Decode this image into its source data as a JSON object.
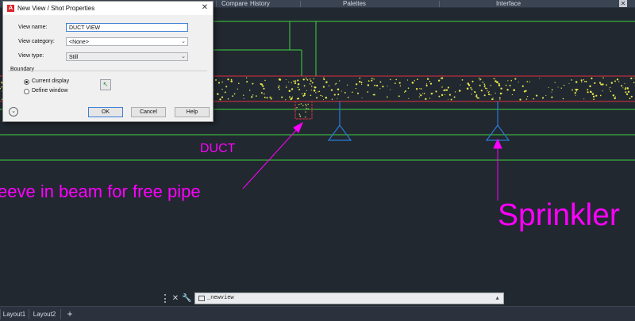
{
  "ribbon": {
    "tabs": [
      {
        "label": "Compare"
      },
      {
        "label": "History"
      },
      {
        "label": "Palettes"
      },
      {
        "label": "Interface"
      }
    ]
  },
  "drawing": {
    "annotations": {
      "duct": "DUCT",
      "sleeve": "eeve in beam for free pipe",
      "sprinkler": "Sprinkler"
    },
    "colors": {
      "background": "#212830",
      "green_lines": "#3fd23f",
      "red_beam": "#e03040",
      "blue_sprinkler": "#2b7bd6",
      "magenta_text": "#ff00ff",
      "speckle": "#e6e64a"
    }
  },
  "dialog": {
    "title": "New View / Shot Properties",
    "view_name_label": "View name:",
    "view_name_value": "DUCT VIEW",
    "view_category_label": "View category:",
    "view_category_value": "<None>",
    "view_type_label": "View type:",
    "view_type_value": "Still",
    "boundary_label": "Boundary",
    "current_display_label": "Current display",
    "define_window_label": "Define window",
    "ok_label": "OK",
    "cancel_label": "Cancel",
    "help_label": "Help"
  },
  "command_line": {
    "text": "_newview"
  },
  "layout_tabs": {
    "items": [
      {
        "label": "Layout1"
      },
      {
        "label": "Layout2"
      },
      {
        "label": "+"
      }
    ]
  }
}
